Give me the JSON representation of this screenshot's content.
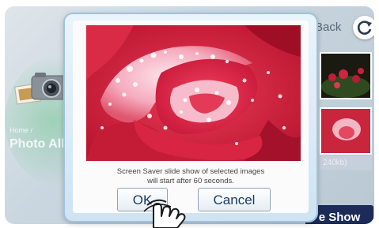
{
  "background": {
    "breadcrumb": "Home /",
    "section_title": "Photo Albu",
    "back_label": "Back",
    "thumbnail_caption": "240kb)",
    "slideshow_label": "e Show"
  },
  "dialog": {
    "message_line1": "Screen Saver slide show of selected images",
    "message_line2": "will start after 60 seconds.",
    "ok_label": "OK",
    "cancel_label": "Cancel"
  },
  "icons": {
    "camera": "camera-icon",
    "refresh": "refresh-icon",
    "pointer": "hand-pointer-icon"
  },
  "colors": {
    "slideshow_button": "#1c2b57",
    "dialog_button_text": "#1d3a66",
    "rose": "#d42c45"
  }
}
